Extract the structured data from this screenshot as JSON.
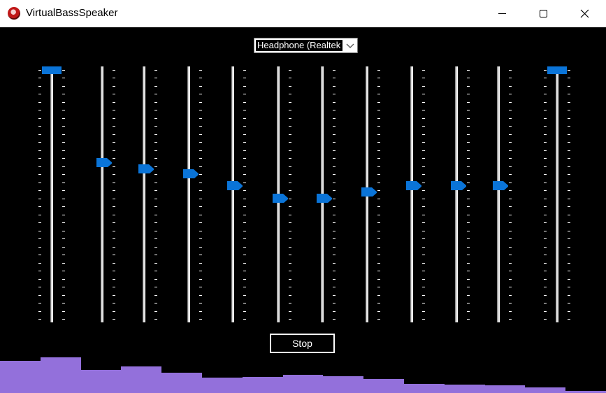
{
  "window": {
    "title": "VirtualBassSpeaker",
    "icon": "app-icon"
  },
  "device": {
    "selected": "Headphone (Realtek"
  },
  "stop_label": "Stop",
  "sliders": [
    {
      "level": 1.0,
      "style": "bar"
    },
    {
      "level": 0.62,
      "style": "arrow"
    },
    {
      "level": 0.595,
      "style": "arrow"
    },
    {
      "level": 0.575,
      "style": "arrow"
    },
    {
      "level": 0.525,
      "style": "arrow"
    },
    {
      "level": 0.475,
      "style": "arrow"
    },
    {
      "level": 0.475,
      "style": "arrow"
    },
    {
      "level": 0.5,
      "style": "arrow"
    },
    {
      "level": 0.525,
      "style": "arrow"
    },
    {
      "level": 0.525,
      "style": "arrow"
    },
    {
      "level": 0.525,
      "style": "arrow"
    },
    {
      "level": 1.0,
      "style": "bar"
    }
  ],
  "spectrum": [
    0.87,
    0.96,
    0.62,
    0.72,
    0.54,
    0.42,
    0.44,
    0.5,
    0.45,
    0.38,
    0.25,
    0.22,
    0.2,
    0.15,
    0.05
  ],
  "colors": {
    "accent": "#0a74d8",
    "spectrum": "#9370db",
    "background": "#000000"
  }
}
